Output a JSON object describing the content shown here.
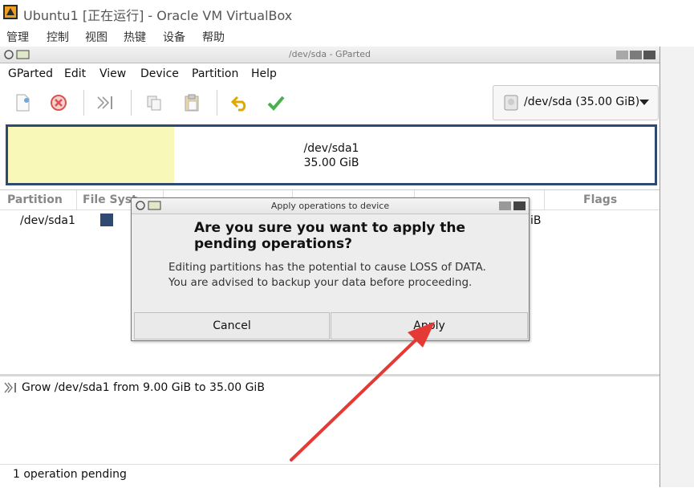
{
  "host": {
    "title": "Ubuntu1 [正在运行] - Oracle VM VirtualBox",
    "menu": [
      "管理",
      "控制",
      "视图",
      "热键",
      "设备",
      "帮助"
    ]
  },
  "gparted": {
    "window_title": "/dev/sda - GParted",
    "menu": [
      "GParted",
      "Edit",
      "View",
      "Device",
      "Partition",
      "Help"
    ],
    "toolbar_icons": [
      "new-icon",
      "delete-icon",
      "resize-move-icon",
      "copy-icon",
      "paste-icon",
      "undo-icon",
      "apply-icon"
    ],
    "device_selector": "/dev/sda (35.00 GiB)",
    "partition_bar": {
      "name": "/dev/sda1",
      "size": "35.00 GiB"
    },
    "columns": [
      "Partition",
      "File Syst",
      "Flags"
    ],
    "rows": [
      {
        "partition": "/dev/sda1",
        "fs_color": "#2f4a70",
        "tail": "iB"
      }
    ],
    "operations": [
      "Grow /dev/sda1 from 9.00 GiB to 35.00 GiB"
    ],
    "status": "1 operation pending"
  },
  "dialog": {
    "title": "Apply operations to device",
    "heading": "Are you sure you want to apply the pending operations?",
    "line1": "Editing partitions has the potential to cause LOSS of DATA.",
    "line2": "You are advised to backup your data before proceeding.",
    "cancel": "Cancel",
    "apply": "Apply"
  },
  "colors": {
    "accent_arrow": "#e53935",
    "partition_border": "#2f4a70",
    "used_fill": "#f8f8b8"
  }
}
